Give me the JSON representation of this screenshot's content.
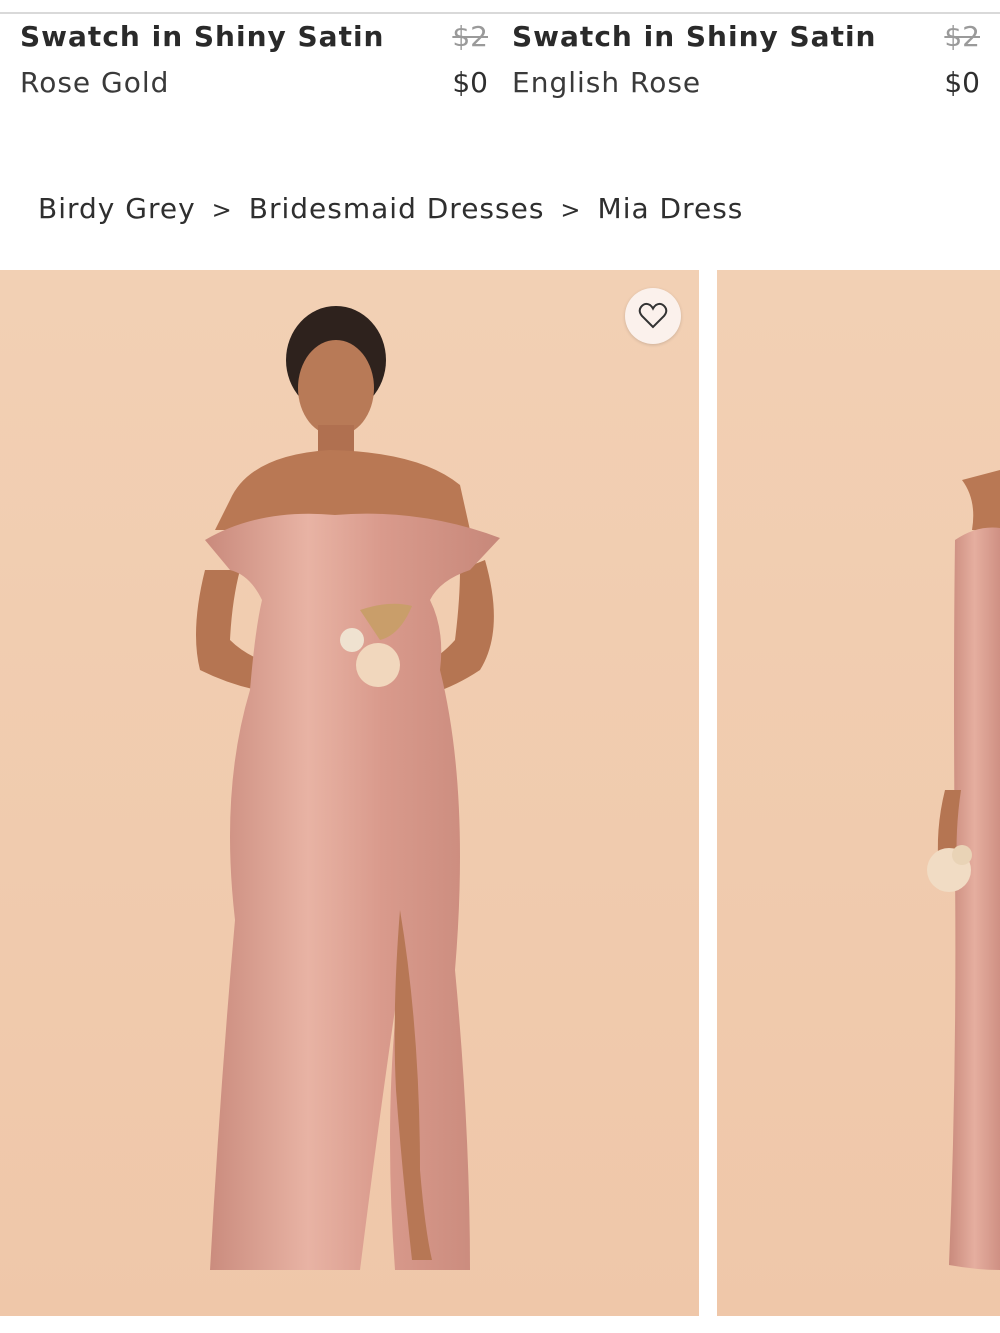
{
  "swatches": [
    {
      "title": "Swatch in Shiny Satin",
      "color": "Rose Gold",
      "old_price": "$2",
      "price": "$0"
    },
    {
      "title": "Swatch in Shiny Satin",
      "color": "English Rose",
      "old_price": "$2",
      "price": "$0"
    }
  ],
  "breadcrumb": {
    "items": [
      "Birdy Grey",
      "Bridesmaid Dresses",
      "Mia Dress"
    ],
    "separator": ">"
  },
  "gallery": {
    "background_color": "#f0cdb0",
    "dress_color": "#d99a8c",
    "icons": {
      "favorite": "heart-outline-icon"
    }
  }
}
